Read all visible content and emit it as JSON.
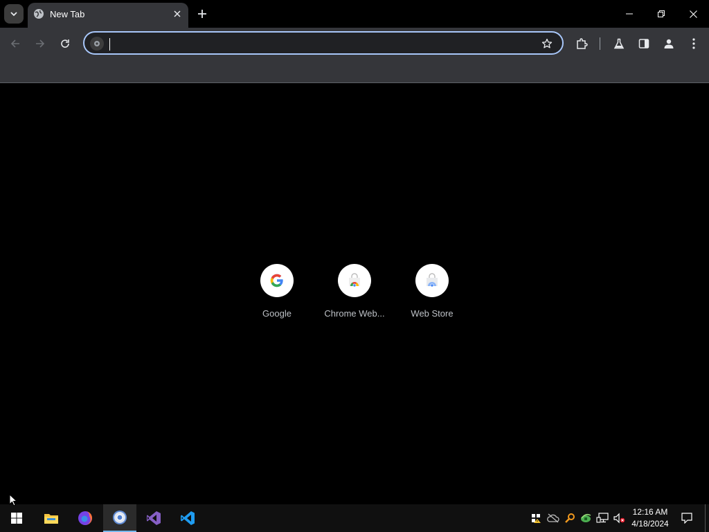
{
  "browser": {
    "tab": {
      "title": "New Tab"
    },
    "omnibox": {
      "value": "",
      "placeholder": ""
    }
  },
  "shortcuts": [
    {
      "label": "Google",
      "icon": "google-icon"
    },
    {
      "label": "Chrome Web...",
      "icon": "chrome-web-store-icon"
    },
    {
      "label": "Web Store",
      "icon": "web-store-icon"
    }
  ],
  "taskbar": {
    "apps": [
      {
        "name": "file-explorer-icon"
      },
      {
        "name": "firefox-icon"
      },
      {
        "name": "chrome-icon"
      },
      {
        "name": "visual-studio-icon"
      },
      {
        "name": "vscode-icon"
      }
    ],
    "clock": {
      "time": "12:16 AM",
      "date": "4/18/2024"
    }
  },
  "colors": {
    "accent": "#a8c7fa",
    "toolbar": "#35363a",
    "taskbar": "#101010"
  }
}
